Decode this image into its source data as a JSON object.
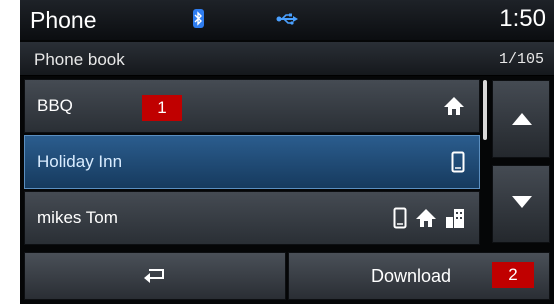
{
  "statusbar": {
    "title": "Phone",
    "time": "1:50",
    "icons": [
      "bluetooth-icon",
      "usb-icon"
    ]
  },
  "header": {
    "title": "Phone book",
    "page_counter": "1/105"
  },
  "contacts": [
    {
      "name": "BBQ",
      "icons": [
        "home-icon"
      ],
      "selected": false
    },
    {
      "name": "Holiday Inn",
      "icons": [
        "mobile-icon"
      ],
      "selected": true
    },
    {
      "name": "mikes Tom",
      "icons": [
        "mobile-icon",
        "home-icon",
        "office-icon"
      ],
      "selected": false
    }
  ],
  "scroll": {
    "up_icon": "scroll-up-icon",
    "down_icon": "scroll-down-icon"
  },
  "footer": {
    "back_icon": "back-icon",
    "download_label": "Download"
  },
  "markers": [
    "1",
    "2"
  ],
  "colors": {
    "selected_row": "#1f4c7a",
    "marker": "#c00000",
    "bluetooth": "#2f7df0",
    "usb": "#4aa0ff"
  }
}
